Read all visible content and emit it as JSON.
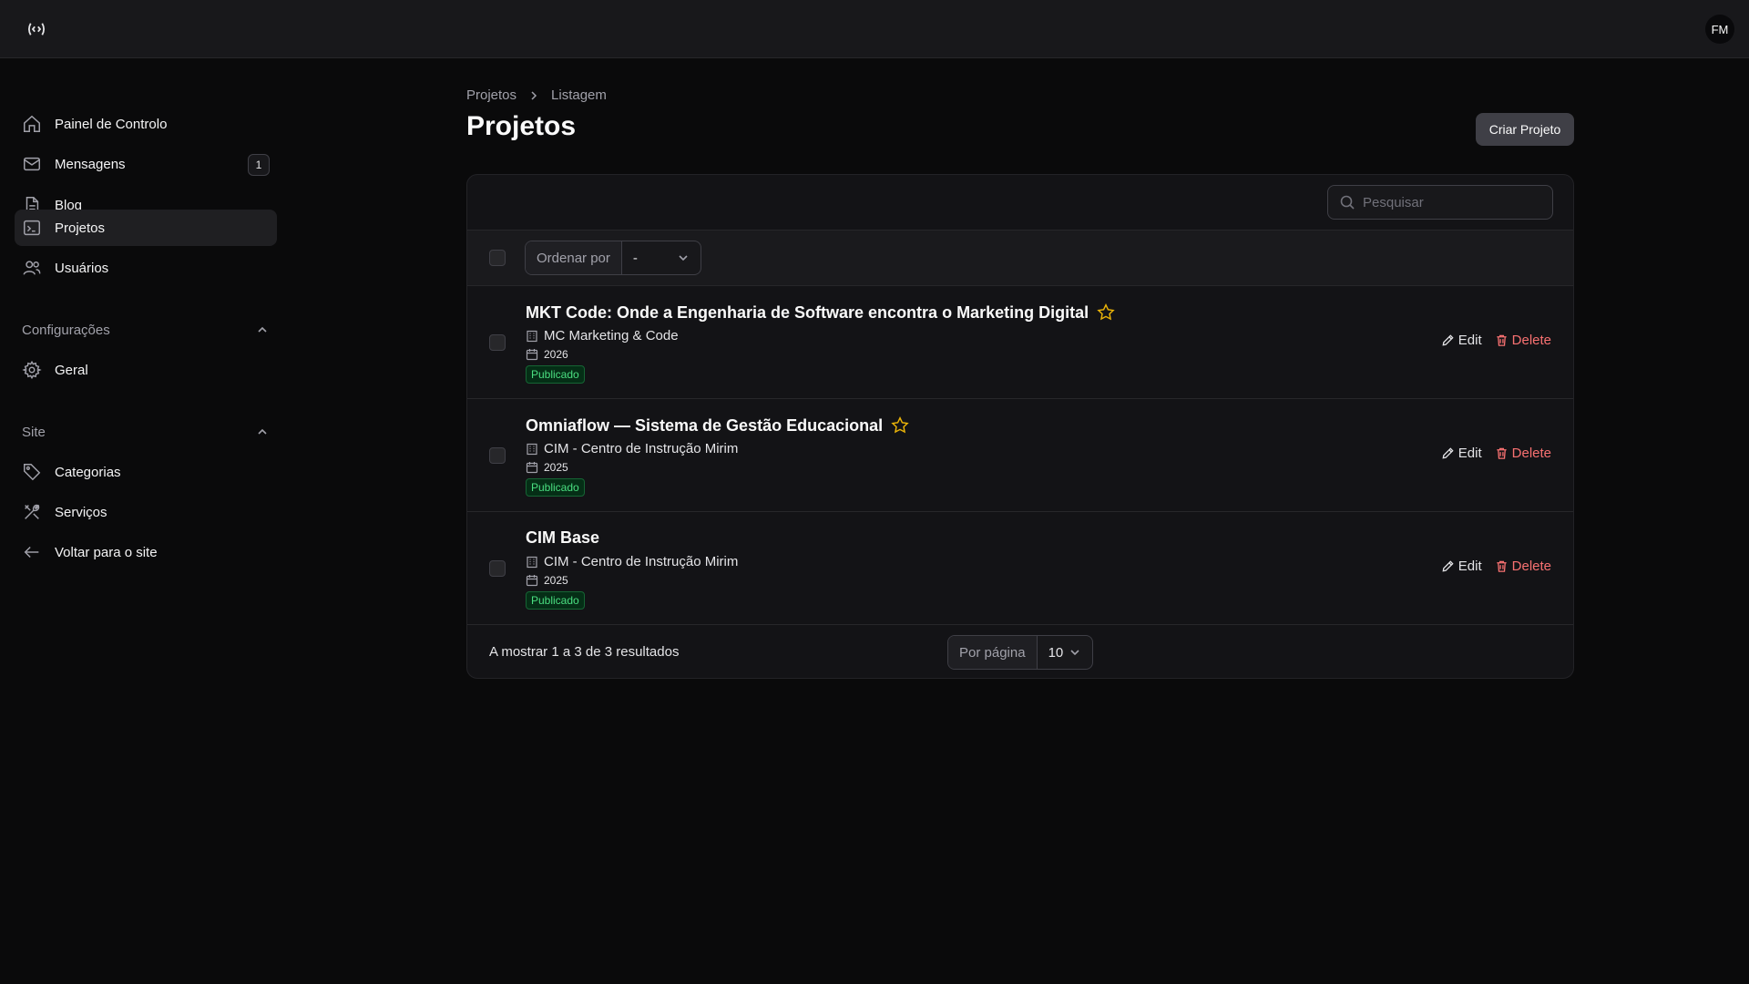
{
  "header": {
    "logo_icon": "code-broadcast-icon",
    "avatar_initials": "FM"
  },
  "sidebar": {
    "items": [
      {
        "label": "Painel de Controlo",
        "icon": "home-icon"
      },
      {
        "label": "Mensagens",
        "icon": "mail-icon",
        "badge": "1"
      },
      {
        "label": "Blog",
        "icon": "document-icon"
      },
      {
        "label": "Projetos",
        "icon": "terminal-window-icon",
        "active": true
      },
      {
        "label": "Usuários",
        "icon": "users-icon"
      }
    ],
    "groups": [
      {
        "label": "Configurações",
        "items": [
          {
            "label": "Geral",
            "icon": "gear-icon"
          }
        ]
      },
      {
        "label": "Site",
        "items": [
          {
            "label": "Categorias",
            "icon": "tag-icon"
          },
          {
            "label": "Serviços",
            "icon": "tools-icon"
          },
          {
            "label": "Voltar para o site",
            "icon": "arrow-left-icon"
          }
        ]
      }
    ]
  },
  "main": {
    "breadcrumb": [
      "Projetos",
      "Listagem"
    ],
    "title": "Projetos",
    "create_button": "Criar Projeto",
    "search_placeholder": "Pesquisar",
    "sort_label": "Ordenar por",
    "sort_value": "-",
    "rows": [
      {
        "title": "MKT Code: Onde a Engenharia de Software encontra o Marketing Digital",
        "starred": true,
        "client": "MC Marketing & Code",
        "year": "2026",
        "status": "Publicado"
      },
      {
        "title": "Omniaflow — Sistema de Gestão Educacional",
        "starred": true,
        "client": "CIM - Centro de Instrução Mirim",
        "year": "2025",
        "status": "Publicado"
      },
      {
        "title": "CIM Base",
        "starred": false,
        "client": "CIM - Centro de Instrução Mirim",
        "year": "2025",
        "status": "Publicado"
      }
    ],
    "edit_label": "Edit",
    "delete_label": "Delete",
    "results_text": "A mostrar 1 a 3 de 3 resultados",
    "per_page_label": "Por página",
    "per_page_value": "10"
  },
  "colors": {
    "accent_star": "#eab308",
    "delete": "#f87171",
    "status_green": "#4ade80"
  }
}
